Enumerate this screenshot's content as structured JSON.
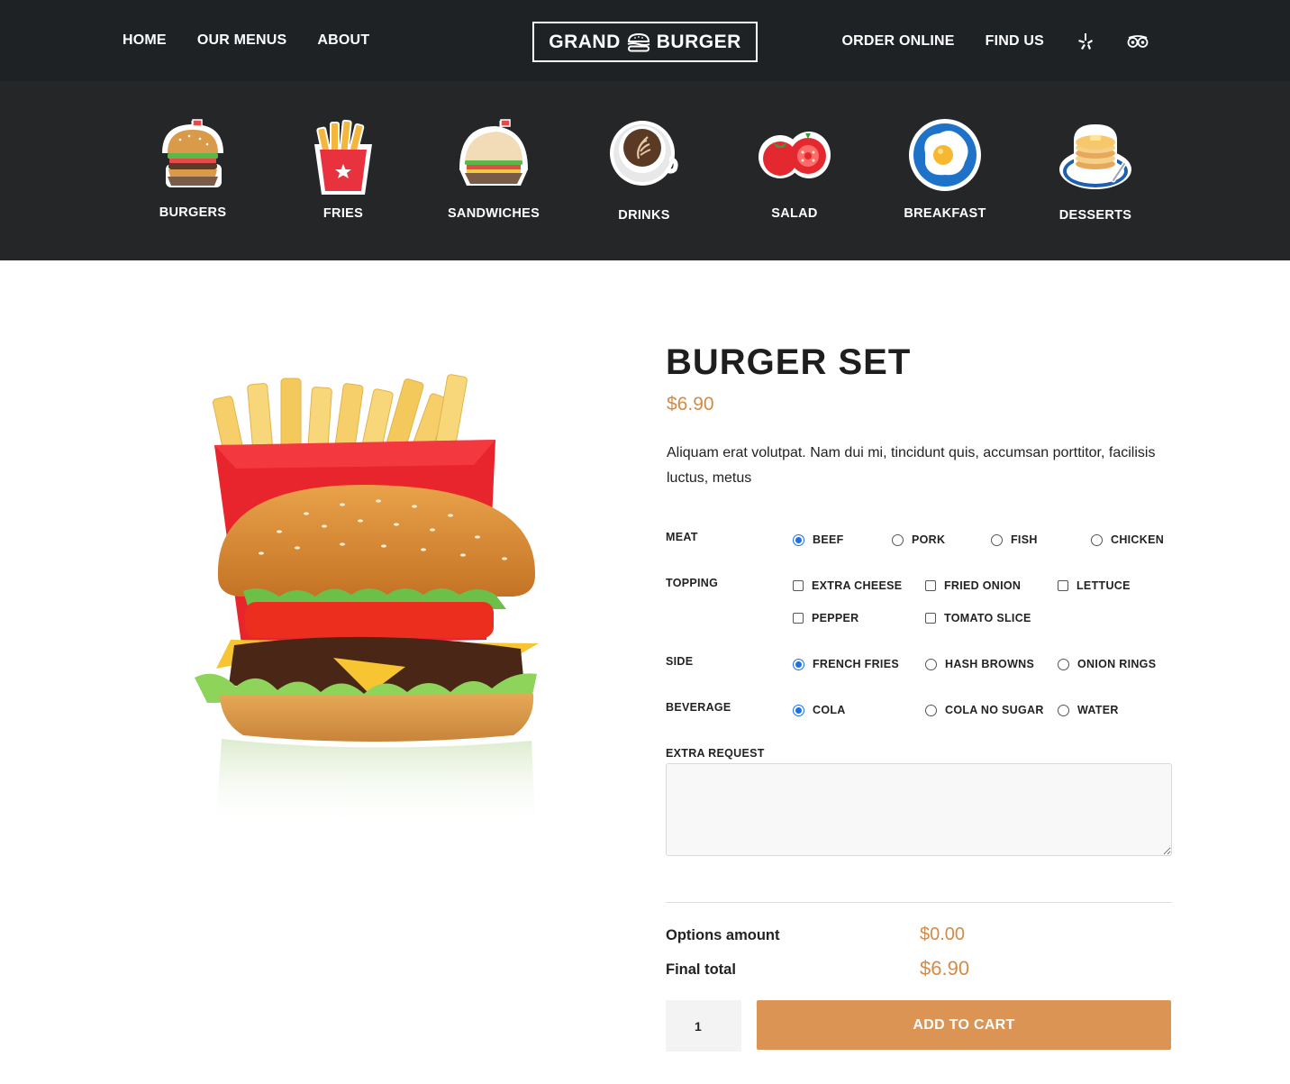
{
  "header": {
    "nav_left": [
      "HOME",
      "OUR MENUS",
      "ABOUT"
    ],
    "logo": {
      "left": "GRAND",
      "right": "BURGER",
      "icon": "burger-icon"
    },
    "nav_right": [
      "ORDER ONLINE",
      "FIND US"
    ],
    "social_icons": [
      "yelp-icon",
      "tripadvisor-icon"
    ]
  },
  "categories": [
    {
      "label": "BURGERS",
      "icon": "burger-icon"
    },
    {
      "label": "FRIES",
      "icon": "fries-icon"
    },
    {
      "label": "SANDWICHES",
      "icon": "sandwich-icon"
    },
    {
      "label": "DRINKS",
      "icon": "coffee-icon"
    },
    {
      "label": "SALAD",
      "icon": "tomato-icon"
    },
    {
      "label": "BREAKFAST",
      "icon": "fried-egg-icon"
    },
    {
      "label": "DESSERTS",
      "icon": "pancakes-icon"
    }
  ],
  "product": {
    "title": "BURGER SET",
    "price": "$6.90",
    "description": "Aliquam erat volutpat. Nam dui mi, tincidunt quis, accumsan porttitor, facilisis luctus, metus",
    "image": "burger-and-fries-photo"
  },
  "options": {
    "meat": {
      "label": "MEAT",
      "choices": [
        "BEEF",
        "PORK",
        "FISH",
        "CHICKEN"
      ],
      "selected": "BEEF"
    },
    "topping": {
      "label": "TOPPING",
      "choices": [
        "EXTRA CHEESE",
        "FRIED ONION",
        "LETTUCE",
        "PEPPER",
        "TOMATO SLICE"
      ],
      "checked": []
    },
    "side": {
      "label": "SIDE",
      "choices": [
        "FRENCH FRIES",
        "HASH BROWNS",
        "ONION RINGS"
      ],
      "selected": "FRENCH FRIES"
    },
    "beverage": {
      "label": "BEVERAGE",
      "choices": [
        "COLA",
        "COLA NO SUGAR",
        "WATER"
      ],
      "selected": "COLA"
    },
    "extra_request": {
      "label": "EXTRA REQUEST",
      "value": ""
    }
  },
  "summary": {
    "options_amount_label": "Options amount",
    "options_amount": "$0.00",
    "final_total_label": "Final total",
    "final_total": "$6.90"
  },
  "cart": {
    "quantity": "1",
    "button_label": "ADD TO CART"
  },
  "colors": {
    "accent": "#dc9455",
    "price": "#d48a45",
    "header_bg": "#1f2225",
    "radio_selected": "#1a73e8"
  }
}
